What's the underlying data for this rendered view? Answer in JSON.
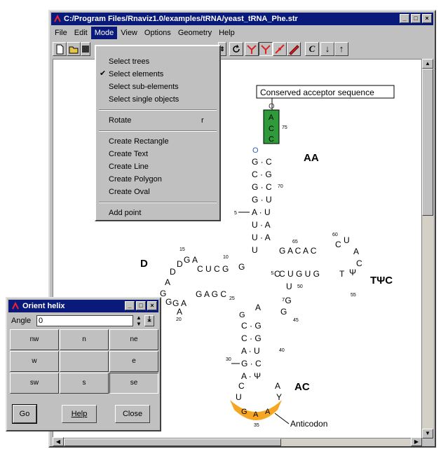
{
  "window": {
    "title": "C:/Program Files/Rnaviz1.0/examples/tRNA/yeast_tRNA_Phe.str",
    "buttons": [
      "_",
      "□",
      "×"
    ]
  },
  "menubar": [
    "File",
    "Edit",
    "Mode",
    "View",
    "Options",
    "Geometry",
    "Help"
  ],
  "mode_menu": {
    "items": [
      {
        "label": "Select trees",
        "checked": false
      },
      {
        "label": "Select elements",
        "checked": true
      },
      {
        "label": "Select sub-elements",
        "checked": false
      },
      {
        "label": "Select single objects",
        "checked": false
      },
      {
        "label": "Rotate",
        "shortcut": "r"
      },
      {
        "label": "Create Rectangle"
      },
      {
        "label": "Create Text"
      },
      {
        "label": "Create Line"
      },
      {
        "label": "Create Polygon"
      },
      {
        "label": "Create Oval"
      },
      {
        "label": "Add point"
      }
    ]
  },
  "toolbar": {
    "icons": [
      "new-icon",
      "open-icon",
      "save-icon",
      "spin-icon",
      "rotate-icon",
      "select-tree-icon",
      "select-element-icon",
      "draw-icon",
      "pencil-icon",
      "curve-icon",
      "down-arrow-icon",
      "up-arrow-icon"
    ],
    "curve_label": "C"
  },
  "structure": {
    "labels": {
      "aa": "AA",
      "d": "D",
      "tpc": "TΨC",
      "ac": "AC"
    },
    "callouts": {
      "acceptor": "Conserved acceptor sequence",
      "anticodon": "Anticodon"
    },
    "numbers": {
      "n75": "75",
      "n70": "70",
      "n65": "65",
      "n60": "60",
      "n55": "55",
      "n50": "50",
      "n45": "45",
      "n40": "40",
      "n35": "35",
      "n30": "30",
      "n25": "25",
      "n20": "20",
      "n15": "15",
      "n10": "10",
      "n5": "5"
    },
    "colors": {
      "acceptor_box": "#2e9a3a",
      "anticodon_highlight": "#f5a623"
    }
  },
  "orient_dialog": {
    "title": "Orient helix",
    "angle_label": "Angle",
    "angle_value": "0",
    "grid": [
      "nw",
      "n",
      "ne",
      "w",
      "",
      "e",
      "sw",
      "s",
      "se"
    ],
    "buttons": {
      "go": "Go",
      "help": "Help",
      "close": "Close"
    }
  }
}
